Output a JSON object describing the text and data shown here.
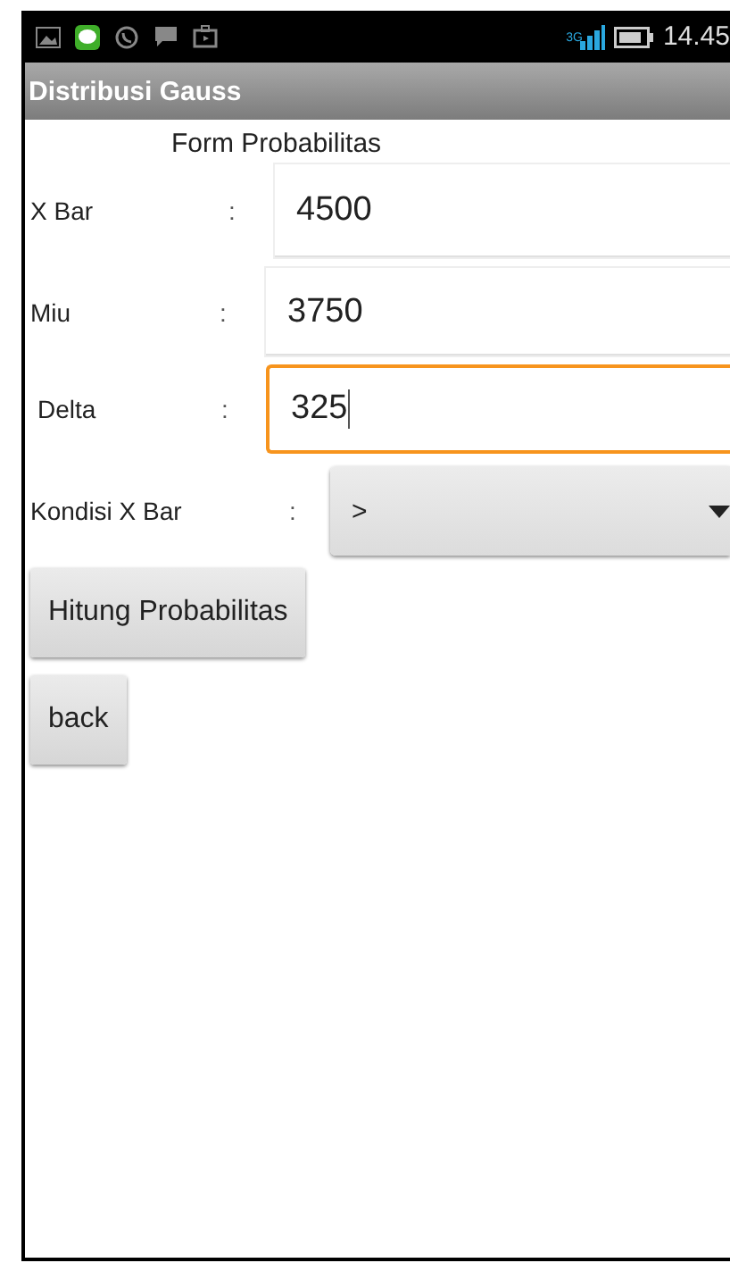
{
  "status_bar": {
    "network": "3G",
    "time": "14.45"
  },
  "app_bar": {
    "title": "Distribusi Gauss"
  },
  "form": {
    "heading": "Form Probabilitas",
    "fields": [
      {
        "label": "X Bar",
        "separator": ":",
        "value": "4500",
        "focused": false
      },
      {
        "label": "Miu",
        "separator": ":",
        "value": "3750",
        "focused": false
      },
      {
        "label": "Delta",
        "separator": ":",
        "value": "325",
        "focused": true
      }
    ],
    "condition": {
      "label": "Kondisi X Bar",
      "separator": ":",
      "value": ">"
    },
    "buttons": [
      "Hitung Probabilitas",
      "back"
    ]
  }
}
